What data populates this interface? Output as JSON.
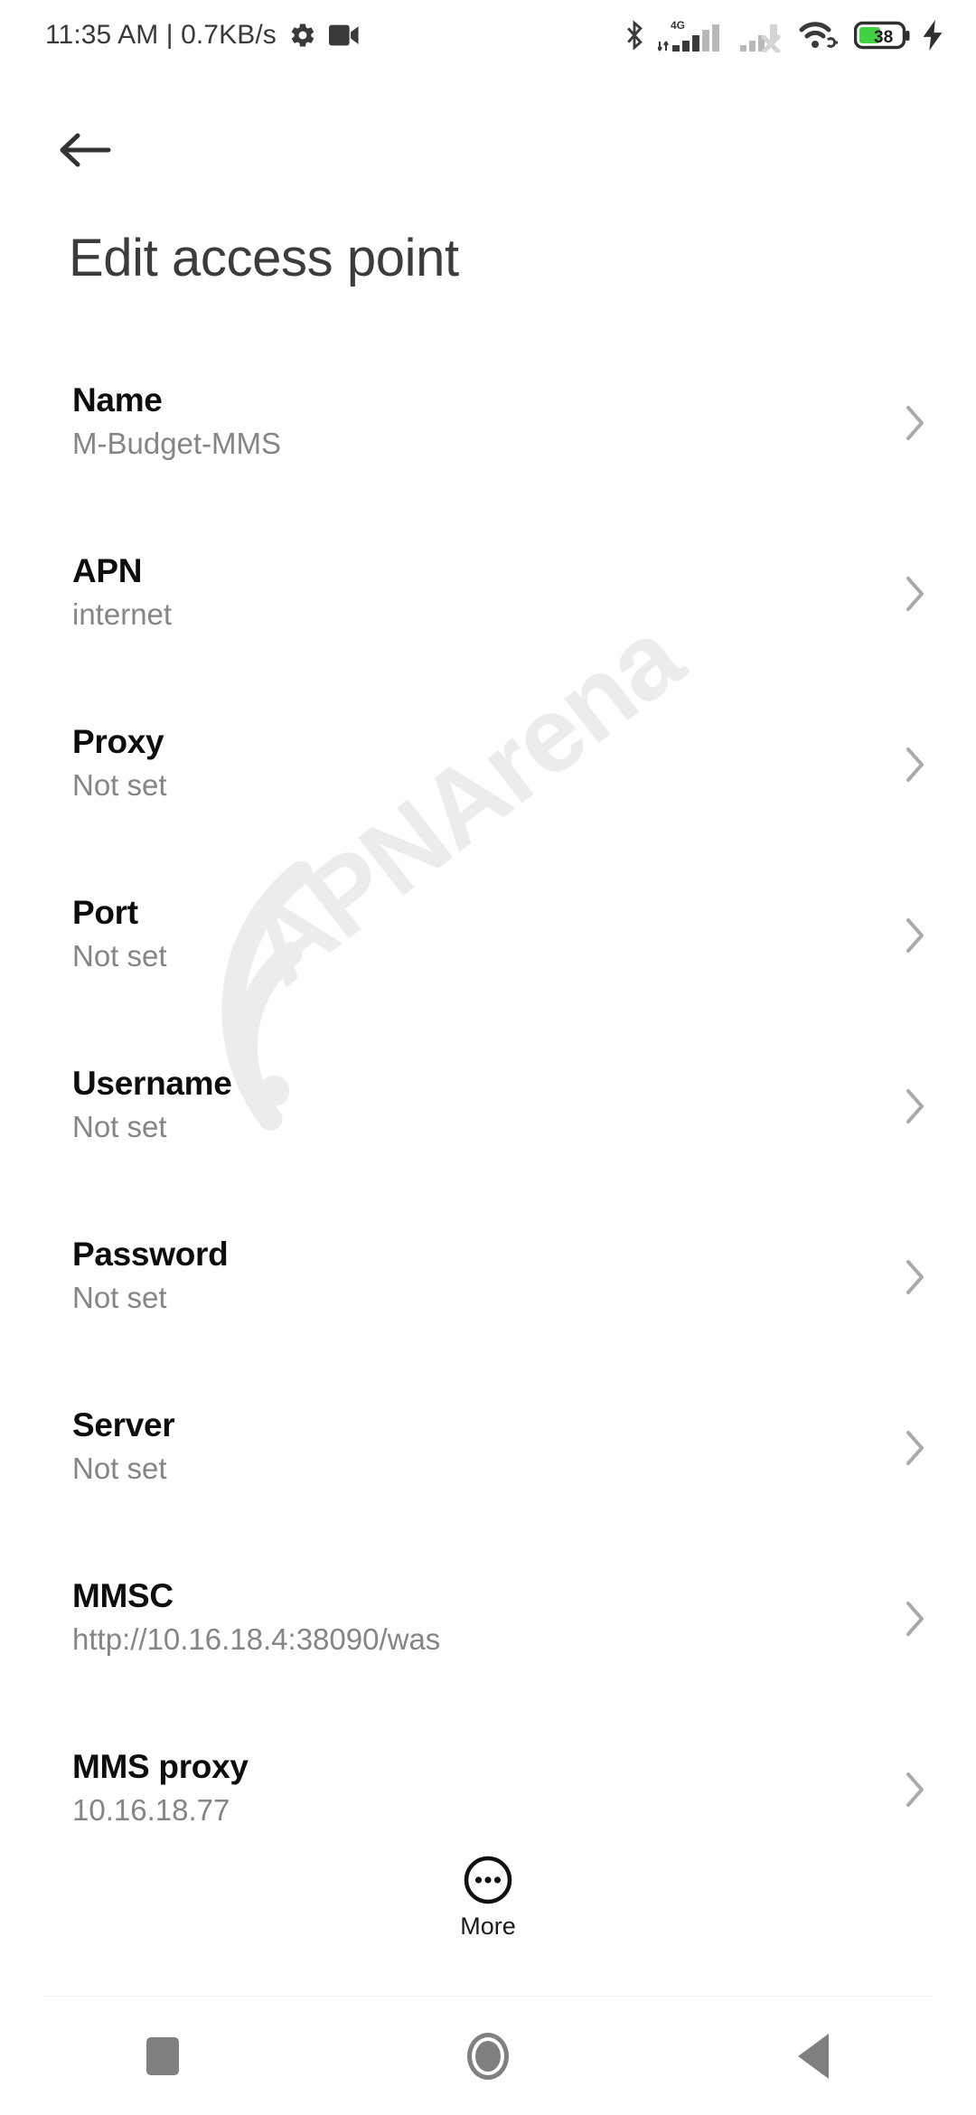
{
  "status_bar": {
    "clock": "11:35 AM | 0.7KB/s",
    "icons_left": [
      "gear-icon",
      "video-camera-icon"
    ],
    "icons_right": [
      "bluetooth-icon",
      "signal-4g-icon",
      "signal-no-service-icon",
      "wifi-link-icon",
      "battery-icon",
      "charging-bolt-icon"
    ],
    "network_type": "4G",
    "battery_percent": "38",
    "battery_color": "#43d143",
    "charging": true
  },
  "app_bar": {
    "back_label": "Back",
    "title": "Edit access point"
  },
  "watermark": {
    "text": "APNArena",
    "color": "#ececec"
  },
  "settings": {
    "rows": [
      {
        "label": "Name",
        "value": "M-Budget-MMS"
      },
      {
        "label": "APN",
        "value": "internet"
      },
      {
        "label": "Proxy",
        "value": "Not set"
      },
      {
        "label": "Port",
        "value": "Not set"
      },
      {
        "label": "Username",
        "value": "Not set"
      },
      {
        "label": "Password",
        "value": "Not set"
      },
      {
        "label": "Server",
        "value": "Not set"
      },
      {
        "label": "MMSC",
        "value": "http://10.16.18.4:38090/was"
      },
      {
        "label": "MMS proxy",
        "value": "10.16.18.77"
      }
    ]
  },
  "more_button": {
    "label": "More",
    "icon": "more-circle-icon"
  },
  "nav_bar": {
    "recents_label": "Recents",
    "home_label": "Home",
    "back_label": "Back"
  }
}
